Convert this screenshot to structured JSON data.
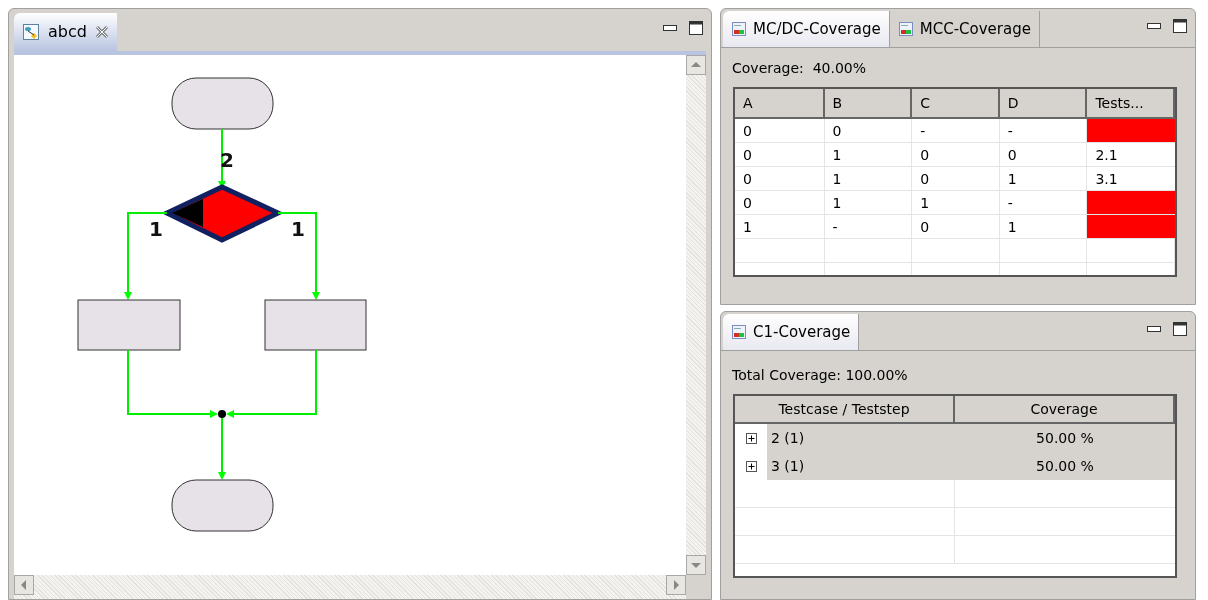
{
  "editor": {
    "tabs": [
      {
        "label": "abcd",
        "selected": true
      }
    ],
    "diagram": {
      "edge_labels": [
        "2",
        "1",
        "1"
      ]
    }
  },
  "coverage_view": {
    "tabs": [
      {
        "label": "MC/DC-Coverage",
        "selected": true
      },
      {
        "label": "MCC-Coverage",
        "selected": false
      }
    ],
    "summary": "Coverage:  40.00%",
    "table": {
      "columns": [
        "A",
        "B",
        "C",
        "D",
        "Tests..."
      ],
      "rows": [
        {
          "cells": [
            "0",
            "0",
            "-",
            "-"
          ],
          "covered": false
        },
        {
          "cells": [
            "0",
            "1",
            "0",
            "0"
          ],
          "tests": "2.1",
          "covered": true
        },
        {
          "cells": [
            "0",
            "1",
            "0",
            "1"
          ],
          "tests": "3.1",
          "covered": true
        },
        {
          "cells": [
            "0",
            "1",
            "1",
            "-"
          ],
          "covered": false
        },
        {
          "cells": [
            "1",
            "-",
            "0",
            "1"
          ],
          "covered": false
        }
      ]
    }
  },
  "c1_view": {
    "tabs": [
      {
        "label": "C1-Coverage",
        "selected": true
      }
    ],
    "summary": "Total Coverage: 100.00%",
    "table": {
      "columns": [
        "Testcase / Teststep",
        "Coverage"
      ],
      "rows": [
        {
          "label": "2 (1)",
          "coverage": "50.00 %",
          "expanded": false
        },
        {
          "label": "3 (1)",
          "coverage": "50.00 %",
          "expanded": false
        }
      ]
    }
  }
}
